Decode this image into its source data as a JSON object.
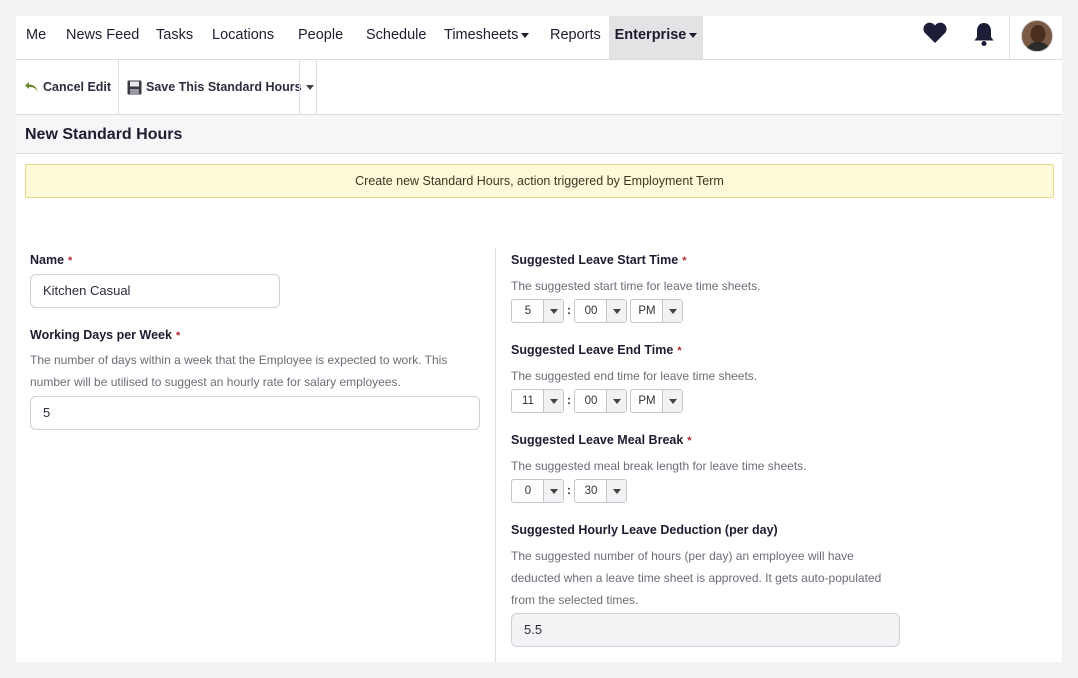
{
  "nav": {
    "items": [
      "Me",
      "News Feed",
      "Tasks",
      "Locations",
      "People",
      "Schedule",
      "Timesheets",
      "Reports",
      "Enterprise"
    ]
  },
  "toolbar": {
    "cancel_label": "Cancel Edit",
    "save_label": "Save This Standard Hours"
  },
  "page": {
    "title": "New Standard Hours",
    "notice": "Create new Standard Hours, action triggered by Employment Term"
  },
  "form": {
    "name": {
      "label": "Name",
      "value": "Kitchen Casual"
    },
    "working_days": {
      "label": "Working Days per Week",
      "help_line1": "The number of days within a week that the Employee is expected to work. This",
      "help_line2": "number will be utilised to suggest an hourly rate for salary employees.",
      "value": "5"
    },
    "leave_start": {
      "label": "Suggested Leave Start Time",
      "help": "The suggested start time for leave time sheets.",
      "hour": "5",
      "minute": "00",
      "ampm": "PM"
    },
    "leave_end": {
      "label": "Suggested Leave End Time",
      "help": "The suggested end time for leave time sheets.",
      "hour": "11",
      "minute": "00",
      "ampm": "PM"
    },
    "meal_break": {
      "label": "Suggested Leave Meal Break",
      "help": "The suggested meal break length for leave time sheets.",
      "hours": "0",
      "minutes": "30"
    },
    "hourly_deduction": {
      "label": "Suggested Hourly Leave Deduction (per day)",
      "help_line1": "The suggested number of hours (per day) an employee will have",
      "help_line2": "deducted when a leave time sheet is approved. It gets auto-populated",
      "help_line3": "from the selected times.",
      "value": "5.5"
    },
    "required_mark": "*",
    "time_separator": ":"
  },
  "icons": [
    "heart-icon",
    "bell-icon",
    "undo-icon",
    "floppy-disk-icon",
    "caret-down-icon"
  ],
  "colors": {
    "accent": "#1d1d30",
    "notice_bg": "#fdf9d9",
    "required": "#b22a2a"
  }
}
